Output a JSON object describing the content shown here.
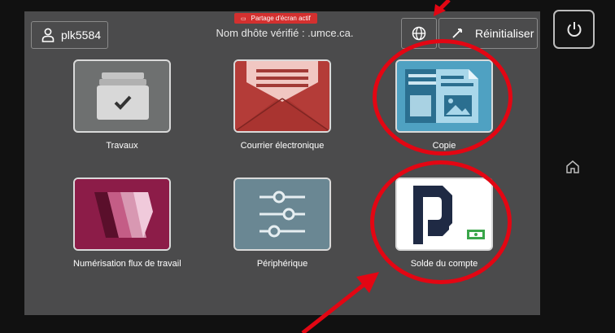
{
  "header": {
    "user_label": "plk5584",
    "share_badge": "Partage d'écran actif",
    "host_text": "Nom dhôte vérifié : .umce.ca.",
    "reset_label": "Réinitialiser"
  },
  "apps": [
    {
      "label": "Travaux"
    },
    {
      "label": "Courrier électronique"
    },
    {
      "label": "Copie"
    },
    {
      "label": "Numérisation flux de travail"
    },
    {
      "label": "Périphérique"
    },
    {
      "label": "Solde du compte"
    }
  ],
  "icons": [
    "user-icon",
    "globe-icon",
    "reset-icon",
    "power-icon",
    "home-icon"
  ],
  "colors": {
    "annotation": "#e30613",
    "share_badge": "#d3302f",
    "screen_bg": "#4b4b4c"
  }
}
